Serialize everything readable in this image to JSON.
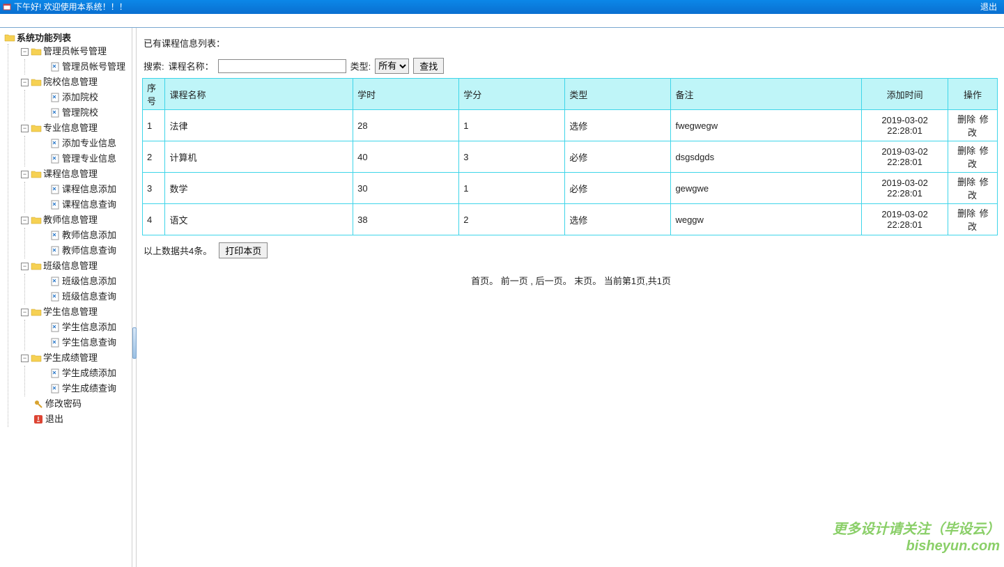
{
  "header": {
    "greeting": "下午好! 欢迎使用本系统！！！",
    "logout": "退出"
  },
  "sidebar": {
    "root": "系统功能列表",
    "groups": [
      {
        "label": "管理员帐号管理",
        "items": [
          "管理员帐号管理"
        ]
      },
      {
        "label": "院校信息管理",
        "items": [
          "添加院校",
          "管理院校"
        ]
      },
      {
        "label": "专业信息管理",
        "items": [
          "添加专业信息",
          "管理专业信息"
        ]
      },
      {
        "label": "课程信息管理",
        "items": [
          "课程信息添加",
          "课程信息查询"
        ]
      },
      {
        "label": "教师信息管理",
        "items": [
          "教师信息添加",
          "教师信息查询"
        ]
      },
      {
        "label": "班级信息管理",
        "items": [
          "班级信息添加",
          "班级信息查询"
        ]
      },
      {
        "label": "学生信息管理",
        "items": [
          "学生信息添加",
          "学生信息查询"
        ]
      },
      {
        "label": "学生成绩管理",
        "items": [
          "学生成绩添加",
          "学生成绩查询"
        ]
      }
    ],
    "password": "修改密码",
    "exit": "退出"
  },
  "content": {
    "title": "已有课程信息列表：",
    "search_label": "搜索:",
    "name_label": "课程名称：",
    "type_label": "类型:",
    "type_selected": "所有",
    "search_button": "查找",
    "columns": [
      "序号",
      "课程名称",
      "学时",
      "学分",
      "类型",
      "备注",
      "添加时间",
      "操作"
    ],
    "rows": [
      {
        "idx": "1",
        "name": "法律",
        "hours": "28",
        "credit": "1",
        "type": "选修",
        "note": "fwegwegw",
        "time": "2019-03-02 22:28:01"
      },
      {
        "idx": "2",
        "name": "计算机",
        "hours": "40",
        "credit": "3",
        "type": "必修",
        "note": "dsgsdgds",
        "time": "2019-03-02 22:28:01"
      },
      {
        "idx": "3",
        "name": "数学",
        "hours": "30",
        "credit": "1",
        "type": "必修",
        "note": "gewgwe",
        "time": "2019-03-02 22:28:01"
      },
      {
        "idx": "4",
        "name": "语文",
        "hours": "38",
        "credit": "2",
        "type": "选修",
        "note": "weggw",
        "time": "2019-03-02 22:28:01"
      }
    ],
    "op_delete": "删除",
    "op_edit": "修改",
    "summary": "以上数据共4条。",
    "print": "打印本页",
    "pager": {
      "first": "首页。",
      "prev": "前一页",
      "next": "后一页。",
      "last": "末页。",
      "status": "当前第1页,共1页"
    }
  },
  "watermark": {
    "l1": "更多设计请关注（毕设云）",
    "l2": "bisheyun.com"
  }
}
